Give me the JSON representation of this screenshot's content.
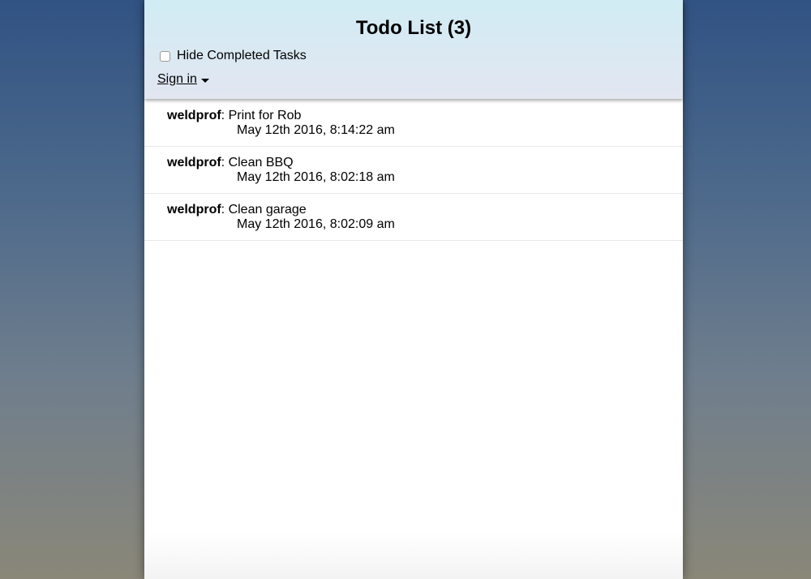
{
  "header": {
    "title": "Todo List (3)",
    "hide_completed_label": "Hide Completed Tasks",
    "hide_completed_checked": false,
    "signin_label": "Sign in"
  },
  "tasks": [
    {
      "user": "weldprof",
      "separator": ": ",
      "text": "Print for Rob",
      "date": "May 12th 2016, 8:14:22 am"
    },
    {
      "user": "weldprof",
      "separator": ": ",
      "text": "Clean BBQ",
      "date": "May 12th 2016, 8:02:18 am"
    },
    {
      "user": "weldprof",
      "separator": ": ",
      "text": "Clean garage",
      "date": "May 12th 2016, 8:02:09 am"
    }
  ],
  "icons": {
    "signin_caret": "caret-down-icon"
  }
}
